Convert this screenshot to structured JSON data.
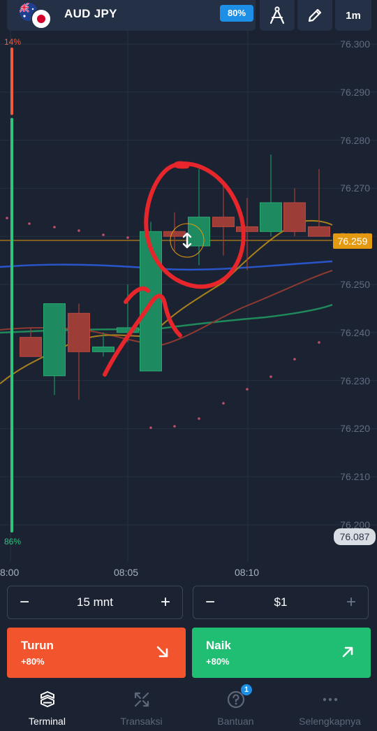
{
  "header": {
    "pair": "AUD JPY",
    "payout": "80%",
    "flags": [
      "australia-flag",
      "japan-flag"
    ],
    "tools": [
      "compass-icon",
      "pencil-icon"
    ],
    "timeframe": "1m"
  },
  "chart_data": {
    "type": "candlestick",
    "y_ticks": [
      "76.300",
      "76.290",
      "76.280",
      "76.270",
      "76.260",
      "76.250",
      "76.240",
      "76.230",
      "76.220",
      "76.210",
      "76.200"
    ],
    "x_ticks": [
      "8:00",
      "08:05",
      "08:10"
    ],
    "current_price": "76.259",
    "low_marker": "76.087",
    "sentiment": {
      "down": "14%",
      "up": "86%",
      "down_value": 14,
      "up_value": 86
    },
    "candles": [
      {
        "o": 76.239,
        "h": 76.241,
        "l": 76.236,
        "c": 76.235
      },
      {
        "o": 76.231,
        "h": 76.243,
        "l": 76.227,
        "c": 76.246
      },
      {
        "o": 76.244,
        "h": 76.246,
        "l": 76.226,
        "c": 76.236
      },
      {
        "o": 76.236,
        "h": 76.24,
        "l": 76.235,
        "c": 76.237
      },
      {
        "o": 76.24,
        "h": 76.25,
        "l": 76.238,
        "c": 76.241
      },
      {
        "o": 76.232,
        "h": 76.263,
        "l": 76.232,
        "c": 76.261
      },
      {
        "o": 76.261,
        "h": 76.265,
        "l": 76.257,
        "c": 76.26
      },
      {
        "o": 76.258,
        "h": 76.274,
        "l": 76.254,
        "c": 76.264
      },
      {
        "o": 76.264,
        "h": 76.271,
        "l": 76.256,
        "c": 76.262
      },
      {
        "o": 76.262,
        "h": 76.268,
        "l": 76.253,
        "c": 76.261
      },
      {
        "o": 76.261,
        "h": 76.277,
        "l": 76.26,
        "c": 76.267
      },
      {
        "o": 76.267,
        "h": 76.27,
        "l": 76.26,
        "c": 76.261
      },
      {
        "o": 76.262,
        "h": 76.274,
        "l": 76.26,
        "c": 76.26
      }
    ],
    "colors": {
      "up": "#1e8a5f",
      "down": "#9c3e37",
      "price_line": "#e49a10",
      "annotation": "#e6262b"
    }
  },
  "controls": {
    "duration": {
      "minus": "−",
      "value": "15 mnt",
      "plus": "+"
    },
    "amount": {
      "minus": "−",
      "value": "$1",
      "plus": "+"
    }
  },
  "trade": {
    "down": {
      "label": "Turun",
      "payout": "+80%",
      "color": "#f2542d"
    },
    "up": {
      "label": "Naik",
      "payout": "+80%",
      "color": "#1fbe72"
    }
  },
  "nav": {
    "items": [
      {
        "label": "Terminal",
        "icon": "terminal-icon"
      },
      {
        "label": "Transaksi",
        "icon": "transactions-icon"
      },
      {
        "label": "Bantuan",
        "icon": "help-icon",
        "badge": "1"
      },
      {
        "label": "Selengkapnya",
        "icon": "more-icon"
      }
    ]
  }
}
